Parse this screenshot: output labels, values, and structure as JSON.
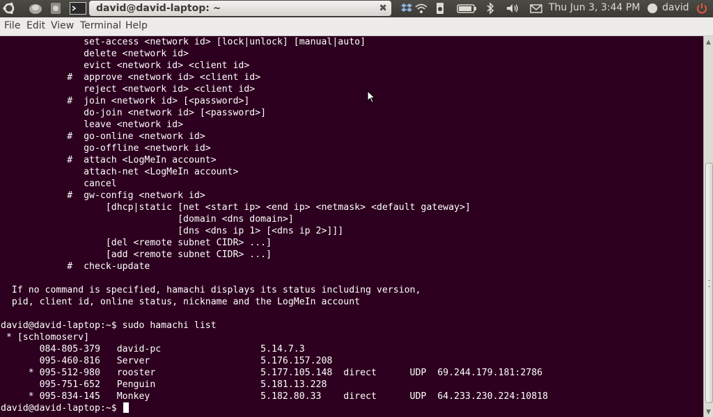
{
  "panel": {
    "icons": [
      "ubuntu-logo-icon",
      "app-launcher-1-icon",
      "app-launcher-2-icon",
      "terminal-launcher-icon"
    ],
    "window_button": {
      "title": "david@david-laptop: ~",
      "close": "✖"
    },
    "tray_icons": [
      "dropbox-icon",
      "wifi-icon",
      "device-manager-icon",
      "battery-icon",
      "bluetooth-icon",
      "volume-icon",
      "mail-icon"
    ],
    "clock": "Thu Jun  3,  3:44 PM",
    "user": "david",
    "colors": {
      "panel_bg": "#3c3b37",
      "power_red": "#e35b3e"
    }
  },
  "menubar": {
    "items": [
      "File",
      "Edit",
      "View",
      "Terminal",
      "Help"
    ]
  },
  "terminal": {
    "background": "#2c001e",
    "foreground": "#ffffff",
    "lines": [
      "               set-access <network id> [lock|unlock] [manual|auto]",
      "               delete <network id>",
      "               evict <network id> <client id>",
      "            #  approve <network id> <client id>",
      "               reject <network id> <client id>",
      "            #  join <network id> [<password>]",
      "               do-join <network id> [<password>]",
      "               leave <network id>",
      "            #  go-online <network id>",
      "               go-offline <network id>",
      "            #  attach <LogMeIn account>",
      "               attach-net <LogMeIn account>",
      "               cancel",
      "            #  gw-config <network id>",
      "                   [dhcp|static [net <start ip> <end ip> <netmask> <default gateway>]",
      "                                [domain <dns domain>]",
      "                                [dns <dns ip 1> [<dns ip 2>]]]",
      "                   [del <remote subnet CIDR> ...]",
      "                   [add <remote subnet CIDR> ...]",
      "            #  check-update",
      "",
      "  If no command is specified, hamachi displays its status including version,",
      "  pid, client id, online status, nickname and the LogMeIn account",
      "",
      "david@david-laptop:~$ sudo hamachi list",
      " * [schlomoserv]",
      "       084-805-379   david-pc                  5.14.7.3",
      "       095-460-816   Server                    5.176.157.208",
      "     * 095-512-980   rooster                   5.177.105.148  direct      UDP  69.244.179.181:2786",
      "       095-751-652   Penguin                   5.181.13.228",
      "     * 095-834-145   Monkey                    5.182.80.33    direct      UDP  64.233.230.224:10818",
      "david@david-laptop:~$ "
    ]
  },
  "scrollbar": {
    "up": "▲",
    "down": "▼"
  }
}
